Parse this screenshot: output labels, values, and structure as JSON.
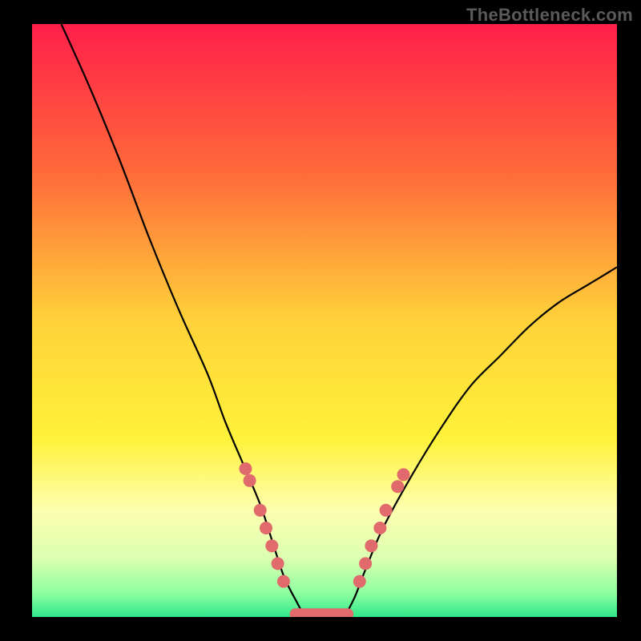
{
  "watermark": "TheBottleneck.com",
  "chart_data": {
    "type": "line",
    "title": "",
    "xlabel": "",
    "ylabel": "",
    "x_range": [
      0,
      100
    ],
    "y_range": [
      0,
      100
    ],
    "x": [
      5,
      10,
      15,
      20,
      25,
      30,
      33,
      36,
      39,
      41,
      43,
      45,
      47,
      50,
      53,
      55,
      57,
      60,
      65,
      70,
      75,
      80,
      85,
      90,
      95,
      100
    ],
    "values": [
      100,
      89,
      77,
      64,
      52,
      41,
      33,
      26,
      19,
      13,
      7,
      3,
      0,
      0,
      0,
      3,
      8,
      15,
      24,
      32,
      39,
      44,
      49,
      53,
      56,
      59
    ],
    "markers_left": [
      {
        "x": 36.5,
        "y": 25
      },
      {
        "x": 37.2,
        "y": 23
      },
      {
        "x": 39.0,
        "y": 18
      },
      {
        "x": 40.0,
        "y": 15
      },
      {
        "x": 41.0,
        "y": 12
      },
      {
        "x": 42.0,
        "y": 9
      },
      {
        "x": 43.0,
        "y": 6
      }
    ],
    "markers_right": [
      {
        "x": 56.0,
        "y": 6
      },
      {
        "x": 57.0,
        "y": 9
      },
      {
        "x": 58.0,
        "y": 12
      },
      {
        "x": 59.5,
        "y": 15
      },
      {
        "x": 60.5,
        "y": 18
      },
      {
        "x": 62.5,
        "y": 22
      },
      {
        "x": 63.5,
        "y": 24
      }
    ],
    "flat_region": {
      "x_start": 45,
      "x_end": 54,
      "y": 0.5
    },
    "gradient_stops": [
      {
        "offset": 0,
        "color": "#ff1f4a"
      },
      {
        "offset": 25,
        "color": "#ff6a3a"
      },
      {
        "offset": 50,
        "color": "#ffd23a"
      },
      {
        "offset": 70,
        "color": "#fff23a"
      },
      {
        "offset": 82,
        "color": "#fdffb0"
      },
      {
        "offset": 90,
        "color": "#dcffb0"
      },
      {
        "offset": 96,
        "color": "#8effa0"
      },
      {
        "offset": 100,
        "color": "#2fe88a"
      }
    ]
  }
}
